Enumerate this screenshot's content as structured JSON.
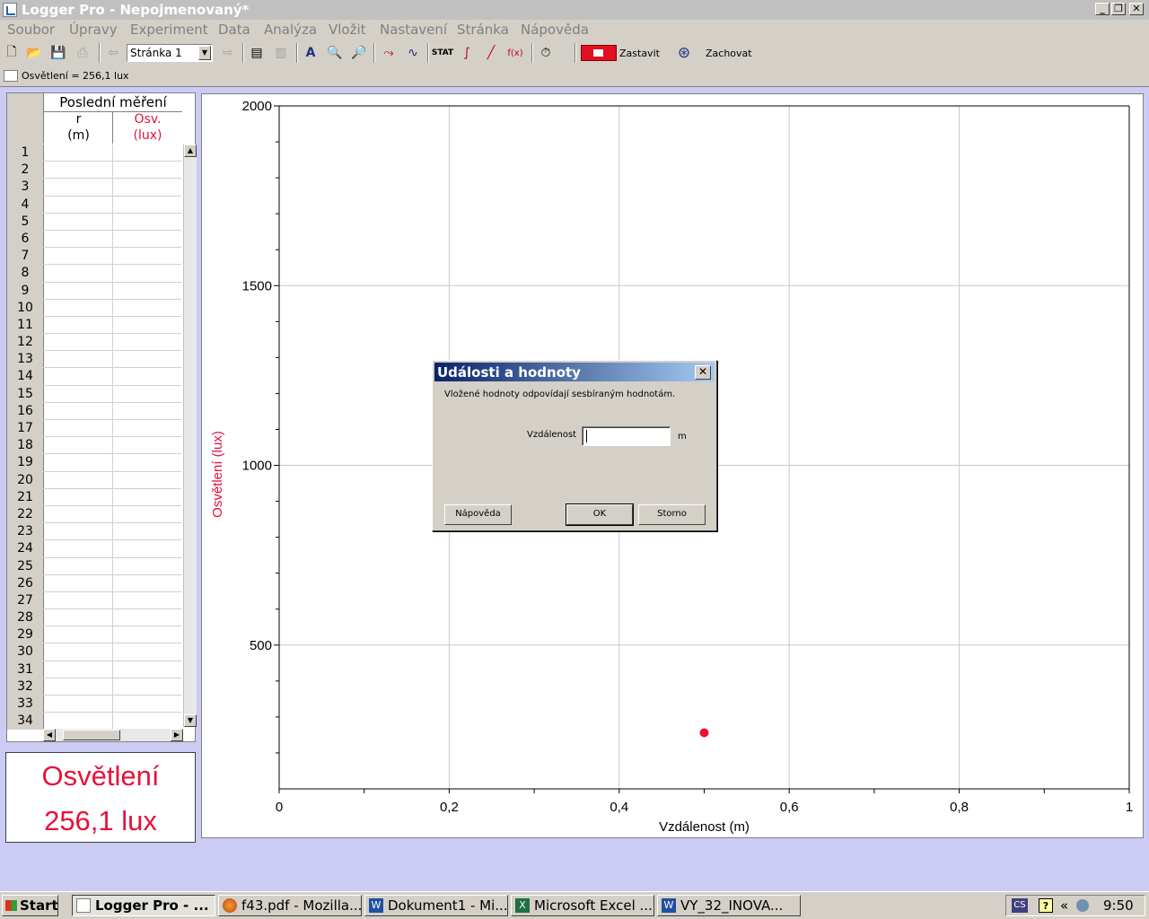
{
  "window": {
    "title": "Logger Pro - Nepojmenovaný*"
  },
  "menu": [
    "Soubor",
    "Úpravy",
    "Experiment",
    "Data",
    "Analýza",
    "Vložit",
    "Nastavení",
    "Stránka",
    "Nápověda"
  ],
  "toolbar": {
    "page_select": "Stránka 1",
    "stop_label": "Zastavit",
    "keep_label": "Zachovat"
  },
  "status": {
    "text": "Osvětlení = 256,1 lux"
  },
  "table": {
    "group_header": "Poslední měření",
    "columns": [
      {
        "name": "r",
        "unit": "(m)",
        "color": "#000000"
      },
      {
        "name": "Osv.",
        "unit": "(lux)",
        "color": "#e8103a"
      }
    ],
    "row_numbers": [
      "1",
      "2",
      "3",
      "4",
      "5",
      "6",
      "7",
      "8",
      "9",
      "10",
      "11",
      "12",
      "13",
      "14",
      "15",
      "16",
      "17",
      "18",
      "19",
      "20",
      "21",
      "22",
      "23",
      "24",
      "25",
      "26",
      "27",
      "28",
      "29",
      "30",
      "31",
      "32",
      "33",
      "34"
    ]
  },
  "meter": {
    "name": "Osvětlení",
    "value": "256,1 lux",
    "color": "#e8103a"
  },
  "chart_data": {
    "type": "scatter",
    "xlabel": "Vzdálenost (m)",
    "ylabel": "Osvětlení (lux)",
    "xlim": [
      0,
      1
    ],
    "ylim": [
      100,
      2000
    ],
    "x_ticks": [
      "0",
      "0,2",
      "0,4",
      "0,6",
      "0,8",
      "1"
    ],
    "x_tick_values": [
      0,
      0.2,
      0.4,
      0.6,
      0.8,
      1
    ],
    "y_ticks": [
      "500",
      "1000",
      "1500",
      "2000"
    ],
    "y_tick_values": [
      500,
      1000,
      1500,
      2000
    ],
    "grid": true,
    "series": [
      {
        "x": [
          0.5
        ],
        "y": [
          256.1
        ],
        "color": "#e8103a"
      }
    ]
  },
  "dialog": {
    "title": "Události a hodnoty",
    "message": "Vložené hodnoty odpovídají sesbíraným hodnotám.",
    "field_label": "Vzdálenost",
    "field_value": "",
    "unit": "m",
    "help_label": "Nápověda",
    "ok_label": "OK",
    "cancel_label": "Storno"
  },
  "taskbar": {
    "start_label": "Start",
    "tasks": [
      "Logger Pro - ...",
      "f43.pdf - Mozilla...",
      "Dokument1 - Mi...",
      "Microsoft Excel ...",
      "VY_32_INOVA..."
    ],
    "lang": "CS",
    "clock": "9:50"
  }
}
